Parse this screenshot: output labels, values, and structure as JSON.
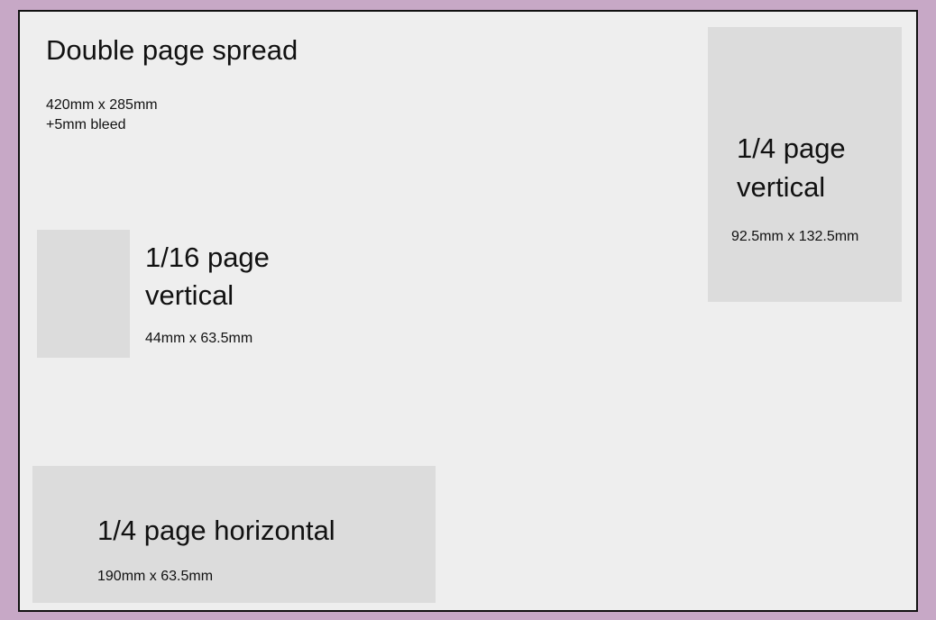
{
  "spread": {
    "title": "Double page spread",
    "size": "420mm x 285mm",
    "bleed": "+5mm bleed"
  },
  "quarter_vertical": {
    "title_line1": "1/4 page",
    "title_line2": "vertical",
    "size": "92.5mm x 132.5mm"
  },
  "sixteenth_vertical": {
    "title_line1": "1/16 page",
    "title_line2": "vertical",
    "size": "44mm x 63.5mm"
  },
  "quarter_horizontal": {
    "title": "1/4 page horizontal",
    "size": "190mm x 63.5mm"
  }
}
